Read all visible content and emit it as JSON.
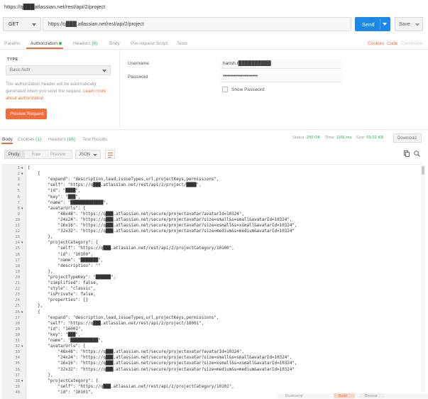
{
  "request": {
    "title": "https://q███atlassian.net/rest/api/2/project",
    "method": "GET",
    "url": "https://q███.atlassian.net/rest/api/2/project",
    "send_label": "Send",
    "save_label": "Save"
  },
  "request_tabs": {
    "params": "Params",
    "authorization": "Authorization",
    "headers": "Headers",
    "headers_count": "(8)",
    "body": "Body",
    "prerequest": "Pre-request Script",
    "tests": "Tests",
    "cookies": "Cookies",
    "code": "Code",
    "comments": "Comments"
  },
  "auth": {
    "type_label": "TYPE",
    "type_value": "Basic Auth",
    "description": "The authorization header will be automatically generated when you send the request.",
    "learn_more": "Learn more about authorization",
    "preview_label": "Preview Request",
    "username_label": "Username",
    "username_value": "harish.r██████████",
    "password_label": "Password",
    "password_value": "•••••••••••••••••••••••••",
    "show_password_label": "Show Password"
  },
  "response_tabs": {
    "body": "Body",
    "cookies": "Cookies",
    "cookies_count": "(1)",
    "headers": "Headers",
    "headers_count": "(16)",
    "test_results": "Test Results"
  },
  "status": {
    "status_label": "Status:",
    "status_value": "200 OK",
    "time_label": "Time:",
    "time_value": "1166 ms",
    "size_label": "Size:",
    "size_value": "69.92 KB",
    "download_label": "Download"
  },
  "viewer": {
    "pretty": "Pretty",
    "raw": "Raw",
    "preview": "Preview",
    "format": "JSON"
  },
  "code_lines": [
    "[",
    "    {",
    "        \"expand\": \"description,lead,issueTypes,url,projectKeys,permissions\",",
    "        \"self\": \"https://q███.atlassian.net/rest/api/2/project/████\",",
    "        \"id\": \"████\",",
    "        \"key\": \"███\",",
    "        \"name\": \"█████████████\",",
    "        \"avatarUrls\": {",
    "            \"48x48\": \"https://q███.atlassian.net/secure/projectavatar?avatarId=10324\",",
    "            \"24x24\": \"https://q███.atlassian.net/secure/projectavatar?size=small&s=small&avatarId=10324\",",
    "            \"16x16\": \"https://q███.atlassian.net/secure/projectavatar?size=xsmall&s=xsmall&avatarId=10324\",",
    "            \"32x32\": \"https://q███.atlassian.net/secure/projectavatar?size=medium&s=medium&avatarId=10324\"",
    "        },",
    "        \"projectCategory\": {",
    "            \"self\": \"https://q███.atlassian.net/rest/api/2/projectCategory/10100\",",
    "            \"id\": \"10100\",",
    "            \"name\": \"███████\",",
    "            \"description\": \"\"",
    "        },",
    "        \"projectTypeKey\": \"██████\",",
    "        \"simplified\": false,",
    "        \"style\": \"classic\",",
    "        \"isPrivate\": false,",
    "        \"properties\": {}",
    "    },",
    "    {",
    "        \"expand\": \"description,lead,issueTypes,url,projectKeys,permissions\",",
    "        \"self\": \"https://q███.atlassian.net/rest/api/2/project/16001\",",
    "        \"id\": \"16001\",",
    "        \"key\": \"███\",",
    "        \"name\": \"███████████\",",
    "        \"avatarUrls\": {",
    "            \"48x48\": \"https://q███.atlassian.net/secure/projectavatar?avatarId=10324\",",
    "            \"24x24\": \"https://q███.atlassian.net/secure/projectavatar?size=small&s=small&avatarId=10324\",",
    "            \"16x16\": \"https://q███.atlassian.net/secure/projectavatar?size=xsmall&s=xsmall&avatarId=10324\",",
    "            \"32x32\": \"https://q███.atlassian.net/secure/projectavatar?size=medium&s=medium&avatarId=10324\"",
    "        },",
    "        \"projectCategory\": {",
    "            \"self\": \"https://q███.atlassian.net/rest/api/2/projectCategory/10101\",",
    "            \"id\": \"10101\","
  ],
  "fold_lines": [
    1,
    2,
    8,
    14,
    26,
    32,
    38
  ],
  "footer": {
    "bootcamp": "Bootcamp",
    "build": "Build",
    "browse": "Browse"
  },
  "colors": {
    "accent": "#f26b3a",
    "send": "#1e88e5",
    "success": "#2fb35b"
  }
}
